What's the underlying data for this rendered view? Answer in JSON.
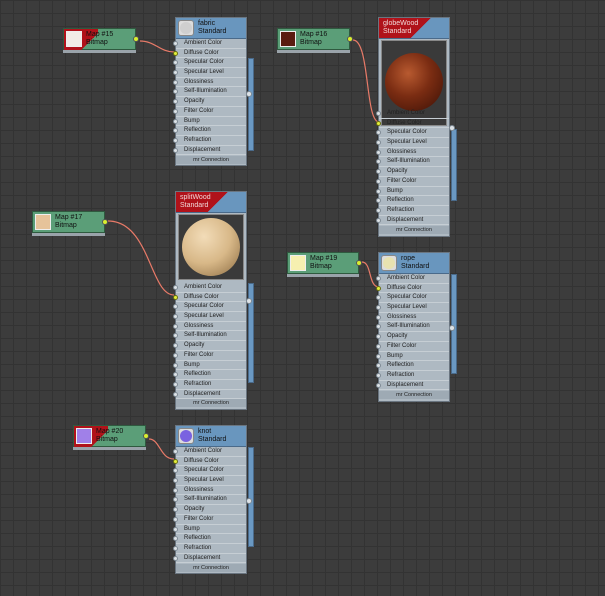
{
  "colors": {
    "canvas": "#3c3c3c",
    "map_node": "#5b9e78",
    "material_header": "#6996be",
    "selected": "#b0121a",
    "wire": "#e87a68",
    "active_pin": "#e4ef3a"
  },
  "slot_labels": [
    "Ambient Color",
    "Diffuse Color",
    "Specular Color",
    "Specular Level",
    "Glossiness",
    "Self-Illumination",
    "Opacity",
    "Filter Color",
    "Bump",
    "Reflection",
    "Refraction",
    "Displacement"
  ],
  "mr_connection": "mr Connection",
  "maps": [
    {
      "id": "m15",
      "name": "Map #15",
      "type": "Bitmap",
      "swatch": "#f2ece6",
      "selected": true
    },
    {
      "id": "m16",
      "name": "Map #16",
      "type": "Bitmap",
      "swatch": "#5a1c10",
      "selected": false
    },
    {
      "id": "m17",
      "name": "Map #17",
      "type": "Bitmap",
      "swatch": "#e6c39a",
      "selected": false
    },
    {
      "id": "m19",
      "name": "Map #19",
      "type": "Bitmap",
      "swatch": "#f6f0b0",
      "selected": false
    },
    {
      "id": "m20",
      "name": "Map #20",
      "type": "Bitmap",
      "swatch": "#a080e8",
      "selected": true
    }
  ],
  "materials": [
    {
      "id": "fabric",
      "name": "fabric",
      "type": "Standard",
      "icon": "#cfcfcf",
      "selected": false,
      "preview": null
    },
    {
      "id": "globewood",
      "name": "globeWood",
      "type": "Standard",
      "icon": "#6a2a14",
      "selected": true,
      "preview": "#7a2c12"
    },
    {
      "id": "splitwood",
      "name": "splitWood",
      "type": "Standard",
      "icon": "#d9b98e",
      "selected": true,
      "preview": "#d8b888"
    },
    {
      "id": "rope",
      "name": "rope",
      "type": "Standard",
      "icon": "#e8e2b0",
      "selected": false,
      "preview": null
    },
    {
      "id": "knot",
      "name": "knot",
      "type": "Standard",
      "icon": "#7a62e0",
      "selected": false,
      "preview": null
    }
  ]
}
